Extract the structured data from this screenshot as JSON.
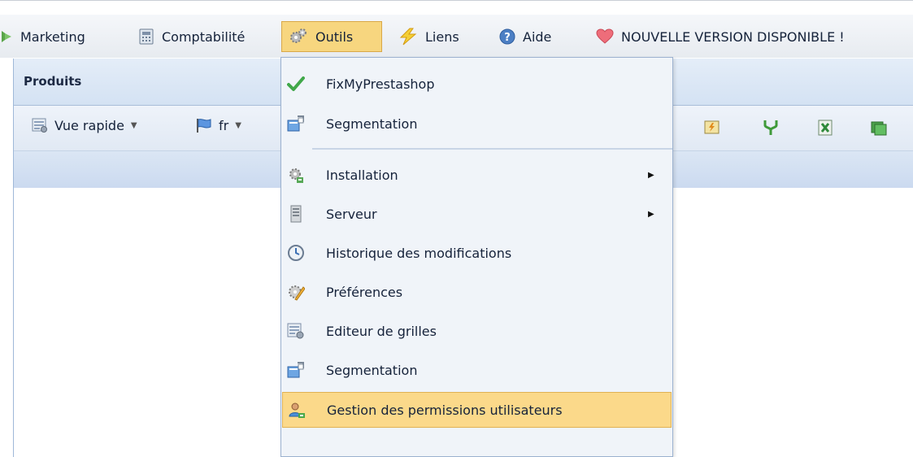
{
  "menubar": {
    "items": [
      {
        "label": "Marketing",
        "icon": "marketing-icon"
      },
      {
        "label": "Comptabilité",
        "icon": "calculator-icon"
      },
      {
        "label": "Outils",
        "icon": "gears-icon"
      },
      {
        "label": "Liens",
        "icon": "lightning-icon"
      },
      {
        "label": "Aide",
        "icon": "help-icon"
      },
      {
        "label": "NOUVELLE VERSION DISPONIBLE !",
        "icon": "heart-icon"
      }
    ]
  },
  "panel": {
    "title": "Produits",
    "view_label": "Vue rapide",
    "lang_label": "fr"
  },
  "dropdown": {
    "items": [
      {
        "label": "FixMyPrestashop",
        "icon": "checkmark-icon",
        "submenu": false
      },
      {
        "label": "Segmentation",
        "icon": "segmentation-icon",
        "submenu": false
      },
      {
        "label": "Installation",
        "icon": "install-gear-icon",
        "submenu": true
      },
      {
        "label": "Serveur",
        "icon": "server-icon",
        "submenu": true
      },
      {
        "label": "Historique des modifications",
        "icon": "clock-icon",
        "submenu": false
      },
      {
        "label": "Préférences",
        "icon": "preferences-icon",
        "submenu": false
      },
      {
        "label": "Editeur de grilles",
        "icon": "grid-editor-icon",
        "submenu": false
      },
      {
        "label": "Segmentation",
        "icon": "segmentation-icon",
        "submenu": false
      },
      {
        "label": "Gestion des permissions utilisateurs",
        "icon": "user-permissions-icon",
        "submenu": false,
        "highlighted": true
      }
    ]
  },
  "colors": {
    "active_menu": "#f7d67f",
    "highlight": "#fbd98a",
    "panel_header": "#d4e2f3"
  }
}
